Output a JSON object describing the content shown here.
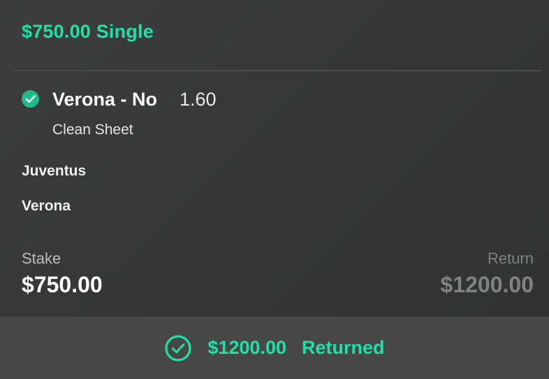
{
  "bet": {
    "title": "$750.00 Single",
    "selection": {
      "name": "Verona - No",
      "odds": "1.60",
      "market": "Clean Sheet",
      "status_icon": "check-circle-filled-icon"
    },
    "teams": {
      "home": "Juventus",
      "away": "Verona"
    },
    "stake": {
      "label": "Stake",
      "value": "$750.00"
    },
    "return": {
      "label": "Return",
      "value": "$1200.00"
    },
    "footer": {
      "amount": "$1200.00",
      "status": "Returned",
      "icon": "check-circle-outline-icon"
    }
  },
  "colors": {
    "accent": "#20e0a5",
    "badge_fill": "#1fb98a",
    "text_primary": "#ffffff",
    "text_muted": "#7f8382",
    "footer_bg": "#454847",
    "card_bg": "#343736"
  }
}
